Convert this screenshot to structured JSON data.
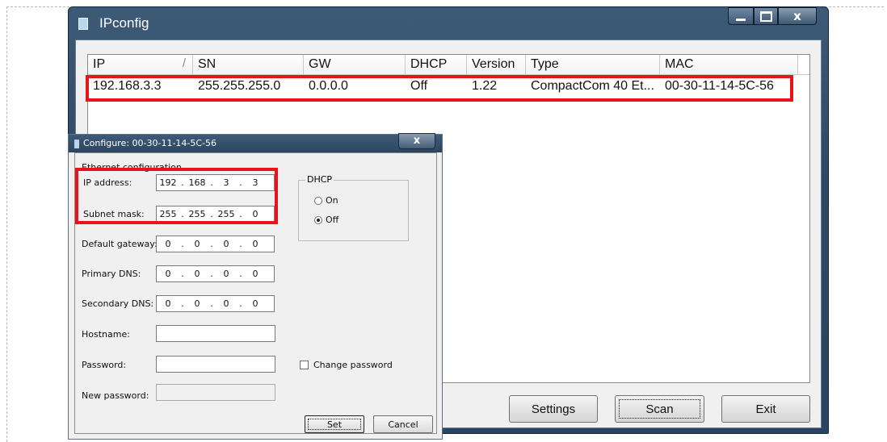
{
  "main_window": {
    "title": "IPconfig",
    "close_label": "x",
    "list": {
      "columns": [
        "IP",
        "SN",
        "GW",
        "DHCP",
        "Version",
        "Type",
        "MAC"
      ],
      "sort_glyph": "/",
      "rows": [
        {
          "ip": "192.168.3.3",
          "sn": "255.255.255.0",
          "gw": "0.0.0.0",
          "dhcp": "Off",
          "version": "1.22",
          "type": "CompactCom 40 Et...",
          "mac": "00-30-11-14-5C-56"
        }
      ]
    },
    "buttons": {
      "settings": "Settings",
      "scan": "Scan",
      "exit": "Exit"
    }
  },
  "dialog": {
    "title": "Configure: 00-30-11-14-5C-56",
    "close_label": "x",
    "group_label": "Ethernet configuration",
    "fields": {
      "ip_label": "IP address:",
      "ip_octets": [
        "192",
        "168",
        "3",
        "3"
      ],
      "subnet_label": "Subnet mask:",
      "subnet_octets": [
        "255",
        "255",
        "255",
        "0"
      ],
      "gateway_label": "Default gateway:",
      "gateway_octets": [
        "0",
        "0",
        "0",
        "0"
      ],
      "primary_dns_label": "Primary DNS:",
      "primary_dns_octets": [
        "0",
        "0",
        "0",
        "0"
      ],
      "secondary_dns_label": "Secondary DNS:",
      "secondary_dns_octets": [
        "0",
        "0",
        "0",
        "0"
      ],
      "hostname_label": "Hostname:",
      "hostname_value": "",
      "password_label": "Password:",
      "password_value": "",
      "new_password_label": "New password:",
      "new_password_value": ""
    },
    "dhcp": {
      "label": "DHCP",
      "on": "On",
      "off": "Off",
      "selected": "Off"
    },
    "change_password_label": "Change password",
    "change_password_checked": false,
    "buttons": {
      "set": "Set",
      "cancel": "Cancel"
    }
  },
  "colors": {
    "highlight": "#e8141a",
    "titlebar": "#2e4965"
  }
}
